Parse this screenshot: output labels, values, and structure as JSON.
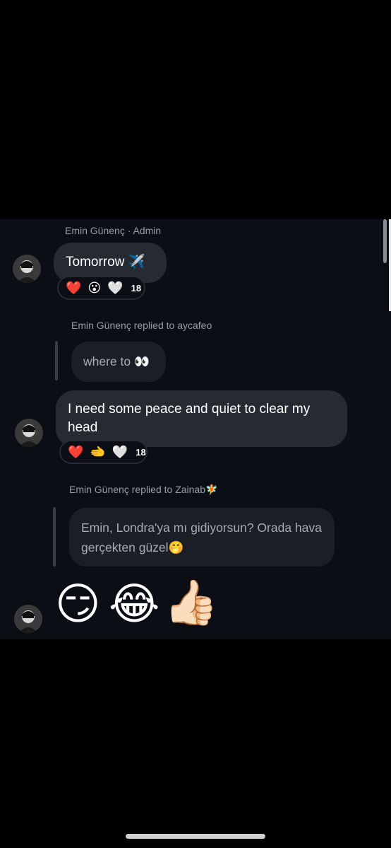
{
  "messages": {
    "m1": {
      "sender_line": "Emin Günenç · Admin",
      "text": "Tomorrow ✈️",
      "reactions": [
        "❤️",
        "😮",
        "🤍"
      ],
      "reaction_count": "18"
    },
    "m2": {
      "reply_header": "Emin Günenç replied to aycafeo",
      "quoted_text": "where to 👀",
      "text": "I need some peace and quiet to clear my head",
      "reactions": [
        "❤️",
        "🫲",
        "🤍"
      ],
      "reaction_count": "18"
    },
    "m3": {
      "reply_header": "Emin Günenç replied to Zainab🧚",
      "quoted_text": "Emin, Londra'ya mı gidiyorsun? Orada hava gerçekten güzel🤭",
      "emojis": [
        "😏",
        "😂",
        "👍🏻"
      ]
    }
  },
  "colors": {
    "background": "#000000",
    "chat_background": "#0b0e14",
    "bubble": "#262a32",
    "reply_bubble": "#1b1e25",
    "meta_text": "#9a9ca3"
  }
}
